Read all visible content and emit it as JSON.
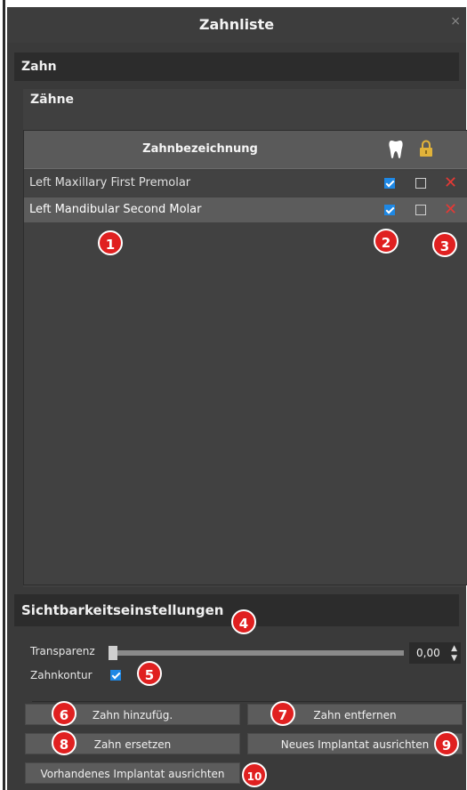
{
  "window": {
    "title": "Zahnliste",
    "close_label": "×"
  },
  "zahn_section": {
    "title": "Zahn"
  },
  "zahne_section": {
    "title": "Zähne"
  },
  "table": {
    "header_name": "Zahnbezeichnung",
    "header_icons": [
      "tooth-icon",
      "lock-icon"
    ],
    "rows": [
      {
        "name": "Left Maxillary First Premolar",
        "visible": true,
        "locked": false
      },
      {
        "name": "Left Mandibular Second Molar",
        "visible": true,
        "locked": false
      }
    ]
  },
  "visibility": {
    "title": "Sichtbarkeitseinstellungen",
    "transparency_label": "Transparenz",
    "transparency_value": "0,00",
    "transparency_level": 0,
    "contour_label": "Zahnkontur",
    "contour_checked": true
  },
  "buttons": {
    "add": "Zahn hinzufüg.",
    "remove": "Zahn entfernen",
    "replace": "Zahn ersetzen",
    "align_new": "Neues Implantat ausrichten",
    "align_existing": "Vorhandenes Implantat ausrichten"
  },
  "badges": [
    "1",
    "2",
    "3",
    "4",
    "5",
    "6",
    "7",
    "8",
    "9",
    "10"
  ],
  "colors": {
    "accent_checkbox": "#1e88e5",
    "delete_red": "#e53935",
    "badge_red": "#e02020",
    "lock_gold": "#e0b23a"
  }
}
